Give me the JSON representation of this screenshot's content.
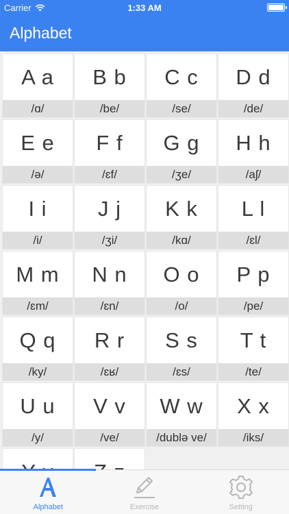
{
  "status": {
    "carrier": "Carrier",
    "time": "1:33 AM"
  },
  "nav": {
    "title": "Alphabet"
  },
  "letters": [
    {
      "letter": "A a",
      "phonetic": "/ɑ/"
    },
    {
      "letter": "B b",
      "phonetic": "/be/"
    },
    {
      "letter": "C c",
      "phonetic": "/se/"
    },
    {
      "letter": "D d",
      "phonetic": "/de/"
    },
    {
      "letter": "E e",
      "phonetic": "/ə/"
    },
    {
      "letter": "F f",
      "phonetic": "/ɛf/"
    },
    {
      "letter": "G g",
      "phonetic": "/ʒe/"
    },
    {
      "letter": "H h",
      "phonetic": "/aʃ/"
    },
    {
      "letter": "I i",
      "phonetic": "/i/"
    },
    {
      "letter": "J j",
      "phonetic": "/ʒi/"
    },
    {
      "letter": "K k",
      "phonetic": "/kɑ/"
    },
    {
      "letter": "L l",
      "phonetic": "/ɛl/"
    },
    {
      "letter": "M m",
      "phonetic": "/ɛm/"
    },
    {
      "letter": "N n",
      "phonetic": "/ɛn/"
    },
    {
      "letter": "O o",
      "phonetic": "/o/"
    },
    {
      "letter": "P p",
      "phonetic": "/pe/"
    },
    {
      "letter": "Q q",
      "phonetic": "/ky/"
    },
    {
      "letter": "R r",
      "phonetic": "/ɛʁ/"
    },
    {
      "letter": "S s",
      "phonetic": "/ɛs/"
    },
    {
      "letter": "T t",
      "phonetic": "/te/"
    },
    {
      "letter": "U u",
      "phonetic": "/y/"
    },
    {
      "letter": "V v",
      "phonetic": "/ve/"
    },
    {
      "letter": "W w",
      "phonetic": "/dublə ve/"
    },
    {
      "letter": "X x",
      "phonetic": "/iks/"
    },
    {
      "letter": "Y y",
      "phonetic": ""
    },
    {
      "letter": "Z z",
      "phonetic": ""
    }
  ],
  "tabs": [
    {
      "label": "Alphabet",
      "icon": "letter-a-icon",
      "active": true
    },
    {
      "label": "Exercise",
      "icon": "pencil-icon",
      "active": false
    },
    {
      "label": "Setting",
      "icon": "gear-icon",
      "active": false
    }
  ],
  "colors": {
    "accent": "#3b82f1",
    "phonetic_bg": "#dedede",
    "inactive": "#b6b6b6"
  }
}
